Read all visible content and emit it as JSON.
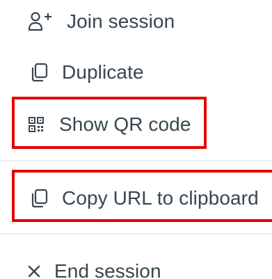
{
  "menu": {
    "items": [
      {
        "label": "Join session",
        "icon": "person-add-icon"
      },
      {
        "label": "Duplicate",
        "icon": "copy-icon"
      },
      {
        "label": "Show QR code",
        "icon": "qr-code-icon"
      },
      {
        "label": "Copy URL to clipboard",
        "icon": "copy-icon"
      },
      {
        "label": "End session",
        "icon": "close-icon"
      }
    ]
  },
  "colors": {
    "text": "#37474f",
    "highlight": "#e50000",
    "divider": "#eceff1"
  }
}
